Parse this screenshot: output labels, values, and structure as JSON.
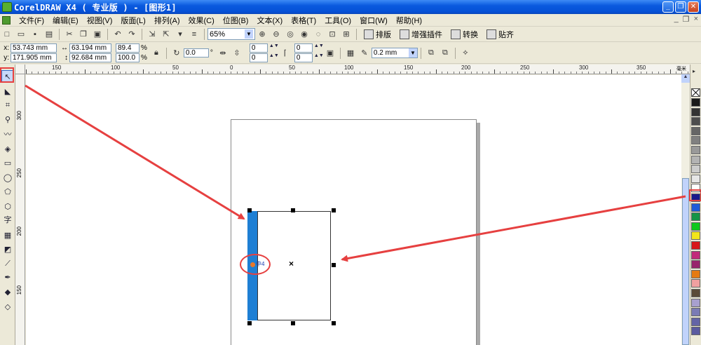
{
  "window": {
    "title": "CorelDRAW X4 ( 专业版 ) - [图形1]",
    "buttons": {
      "minimize": "_",
      "restore": "❐",
      "close": "✕"
    }
  },
  "menu": {
    "items": [
      "文件(F)",
      "编辑(E)",
      "视图(V)",
      "版面(L)",
      "排列(A)",
      "效果(C)",
      "位图(B)",
      "文本(X)",
      "表格(T)",
      "工具(O)",
      "窗口(W)",
      "帮助(H)"
    ],
    "doc_controls": {
      "minimize": "_",
      "restore": "❐",
      "close": "×"
    }
  },
  "toolbar": {
    "zoom_value": "65%",
    "text_buttons": [
      "排版",
      "增强插件",
      "转换",
      "贴齐"
    ]
  },
  "property_bar": {
    "x_label": "x:",
    "x_value": "53.743 mm",
    "y_label": "y:",
    "y_value": "171.905 mm",
    "width_value": "63.194 mm",
    "height_value": "92.684 mm",
    "scale_w": "89.4",
    "scale_h": "100.0",
    "percent": "%",
    "rotation_value": "0.0",
    "degree": "°",
    "corner_values": [
      "0",
      "0",
      "0",
      "0"
    ],
    "outline_width": "0.2 mm"
  },
  "rulers": {
    "h_labels": [
      "150",
      "100",
      "50",
      "0",
      "50",
      "100",
      "150",
      "200",
      "250",
      "300",
      "350"
    ],
    "unit": "毫米",
    "v_labels": [
      "300",
      "250",
      "200",
      "150"
    ]
  },
  "canvas": {
    "anchor_label": "中4"
  },
  "palette": {
    "colors": [
      "#1a1a1a",
      "#333333",
      "#4d4d4d",
      "#666666",
      "#808080",
      "#999999",
      "#b3b3b3",
      "#cccccc",
      "#e6e6e6",
      "#ffffff",
      "#1a1a8c",
      "#1e5bd8",
      "#159447",
      "#10c81c",
      "#f2e51b",
      "#d8181a",
      "#c22a7a",
      "#98246d",
      "#e57a12",
      "#f0a0a0",
      "#5a4a38",
      "#a8a0cf",
      "#7b7bb5",
      "#6464a6",
      "#5a5aa0"
    ]
  },
  "annotation_color": "#e64040",
  "selection_color": "#1e7fd4"
}
